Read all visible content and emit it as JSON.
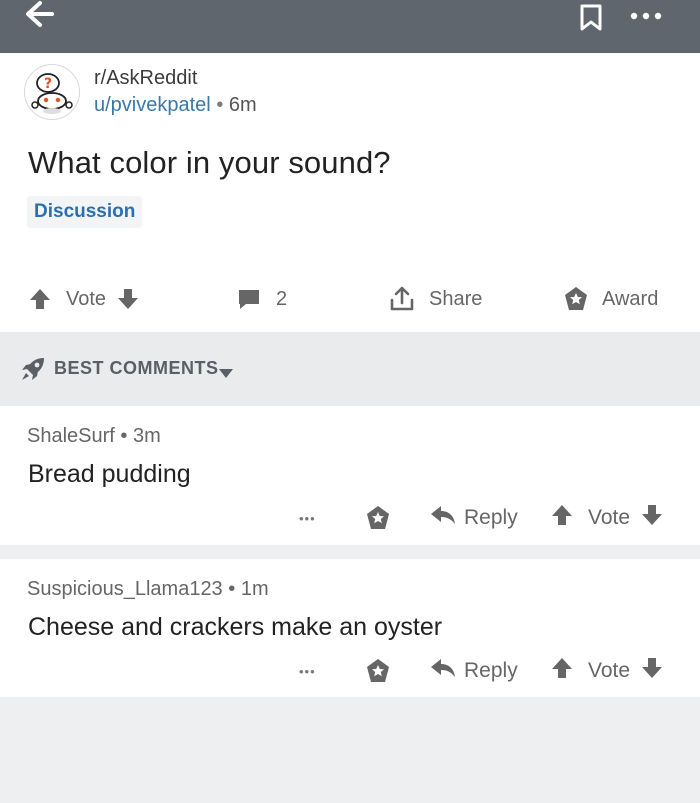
{
  "header": {
    "back_icon": "arrow-left-icon",
    "bookmark_icon": "bookmark-icon",
    "more_icon": "more-dots-icon"
  },
  "post": {
    "subreddit": "r/AskReddit",
    "author": "u/pvivekpatel",
    "separator": "•",
    "age": "6m",
    "title": "What color in your sound?",
    "flair": "Discussion",
    "vote_label": "Vote",
    "comment_count": "2",
    "share_label": "Share",
    "award_label": "Award"
  },
  "sort": {
    "label": "BEST COMMENTS"
  },
  "comments": [
    {
      "author": "ShaleSurf",
      "separator": "•",
      "age": "3m",
      "body": "Bread pudding",
      "more_label": "•••",
      "reply_label": "Reply",
      "vote_label": "Vote"
    },
    {
      "author": "Suspicious_Llama123",
      "separator": "•",
      "age": "1m",
      "body": "Cheese and crackers make an oyster",
      "more_label": "•••",
      "reply_label": "Reply",
      "vote_label": "Vote"
    }
  ],
  "colors": {
    "topbar": "#5f666d",
    "link": "#3a78a8",
    "flair_text": "#2a6fb0",
    "meta_gray": "#666666"
  }
}
